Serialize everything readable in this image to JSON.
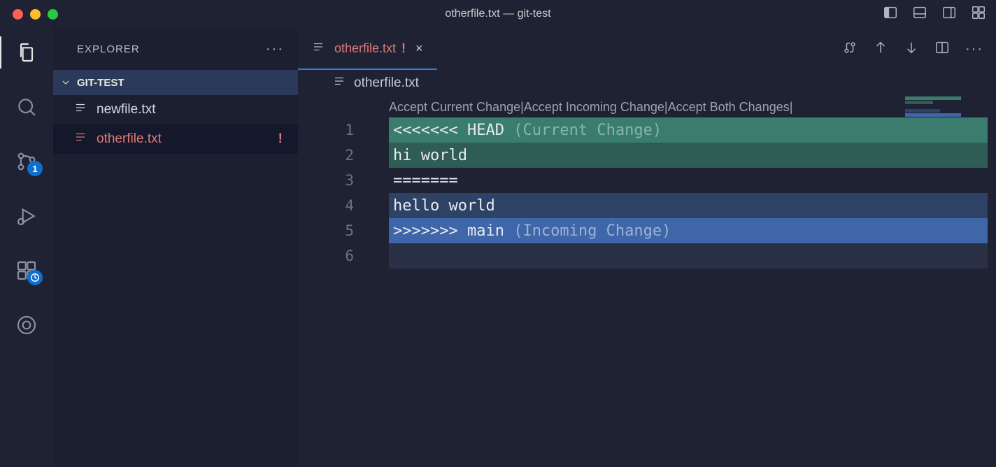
{
  "window": {
    "title": "otherfile.txt — git-test"
  },
  "sidebar": {
    "title": "EXPLORER",
    "folder": "GIT-TEST",
    "files": [
      {
        "name": "newfile.txt",
        "modified": false,
        "status": ""
      },
      {
        "name": "otherfile.txt",
        "modified": true,
        "status": "!"
      }
    ]
  },
  "scm_badge": "1",
  "tab": {
    "filename": "otherfile.txt",
    "modified_indicator": "!",
    "close": "×"
  },
  "breadcrumb": "otherfile.txt",
  "codelens": {
    "accept_current": "Accept Current Change",
    "accept_incoming": "Accept Incoming Change",
    "accept_both": "Accept Both Changes",
    "sep": " | "
  },
  "editor": {
    "lines": [
      {
        "n": "1",
        "a": "<<<<<<< HEAD",
        "b": " (Current Change)",
        "cls": "bg-current-head",
        "dim": "txt-dim"
      },
      {
        "n": "2",
        "a": "hi world",
        "b": "",
        "cls": "bg-current-body",
        "dim": ""
      },
      {
        "n": "3",
        "a": "=======",
        "b": "",
        "cls": "",
        "dim": ""
      },
      {
        "n": "4",
        "a": "hello world",
        "b": "",
        "cls": "bg-incoming-body",
        "dim": ""
      },
      {
        "n": "5",
        "a": ">>>>>>> main",
        "b": " (Incoming Change)",
        "cls": "bg-incoming-head",
        "dim": "txt-dim2"
      },
      {
        "n": "6",
        "a": "",
        "b": "",
        "cls": "bg-cursor",
        "dim": ""
      }
    ]
  }
}
